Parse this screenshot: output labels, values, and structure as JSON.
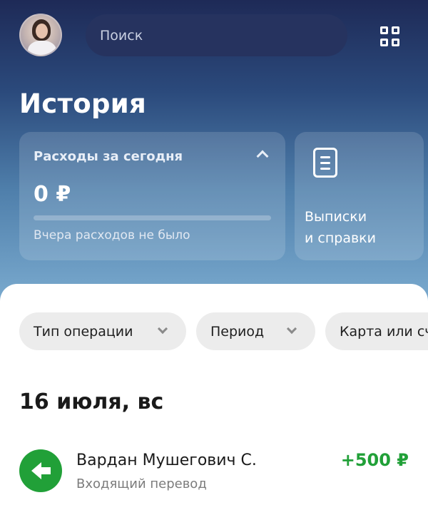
{
  "header": {
    "search_placeholder": "Поиск",
    "avatar_icon": "user-avatar",
    "menu_icon": "grid-icon"
  },
  "page_title": "История",
  "expenses_card": {
    "label": "Расходы за сегодня",
    "amount": "0 ₽",
    "note": "Вчера расходов не было",
    "progress": 0
  },
  "statements_card": {
    "line1": "Выписки",
    "line2": "и справки",
    "icon": "document-icon"
  },
  "filters": [
    {
      "label": "Тип операции"
    },
    {
      "label": "Период"
    },
    {
      "label": "Карта или счёт"
    }
  ],
  "day_header": "16 июля, вс",
  "transactions": [
    {
      "name": "Вардан Мушегович С.",
      "description": "Входящий перевод",
      "amount": "+500 ₽",
      "icon": "incoming-transfer-arrow-icon",
      "amount_color": "#21a038"
    }
  ],
  "colors": {
    "accent_green": "#21a038",
    "header_dark": "#1e2a57"
  }
}
